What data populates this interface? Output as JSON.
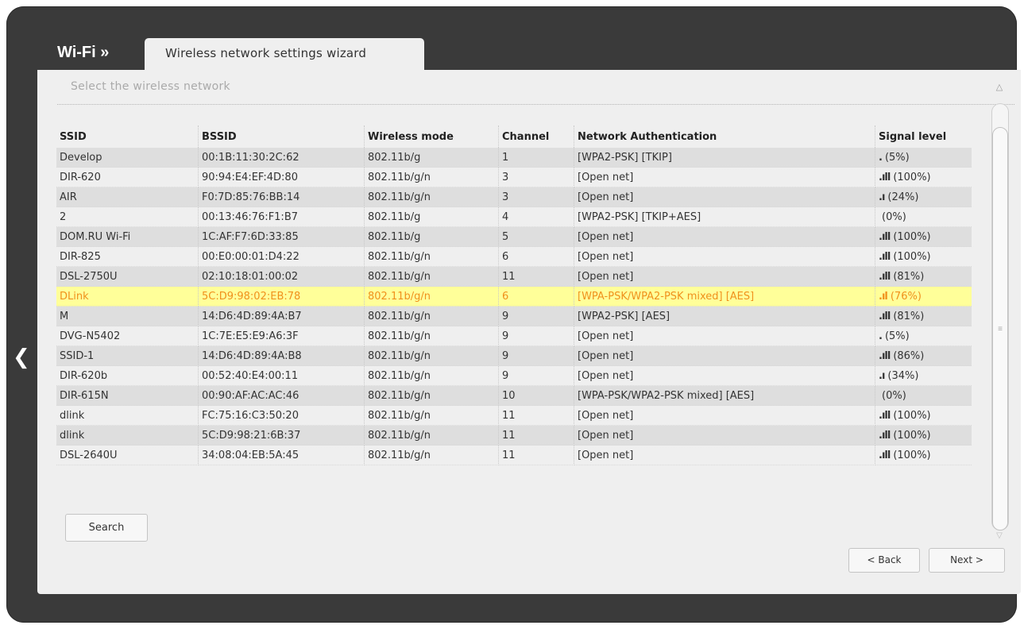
{
  "header": {
    "section": "Wi-Fi »",
    "tab_label": "Wireless network settings wizard"
  },
  "main": {
    "subtitle": "Select the wireless network",
    "columns": [
      "SSID",
      "BSSID",
      "Wireless mode",
      "Channel",
      "Network Authentication",
      "Signal level"
    ],
    "rows": [
      {
        "ssid": "Develop",
        "bssid": "00:1B:11:30:2C:62",
        "mode": "802.11b/g",
        "channel": "1",
        "auth": "[WPA2-PSK] [TKIP]",
        "signal": "(5%)",
        "signal_icon": ".",
        "selected": false
      },
      {
        "ssid": "DIR-620",
        "bssid": "90:94:E4:EF:4D:80",
        "mode": "802.11b/g/n",
        "channel": "3",
        "auth": "[Open net]",
        "signal": "(100%)",
        "signal_icon": ".ıll",
        "selected": false
      },
      {
        "ssid": "AIR",
        "bssid": "F0:7D:85:76:BB:14",
        "mode": "802.11b/g/n",
        "channel": "3",
        "auth": "[Open net]",
        "signal": "(24%)",
        "signal_icon": ".ı",
        "selected": false
      },
      {
        "ssid": "2",
        "bssid": "00:13:46:76:F1:B7",
        "mode": "802.11b/g",
        "channel": "4",
        "auth": "[WPA2-PSK] [TKIP+AES]",
        "signal": "(0%)",
        "signal_icon": "",
        "selected": false
      },
      {
        "ssid": "DOM.RU Wi-Fi",
        "bssid": "1C:AF:F7:6D:33:85",
        "mode": "802.11b/g",
        "channel": "5",
        "auth": "[Open net]",
        "signal": "(100%)",
        "signal_icon": ".ıll",
        "selected": false
      },
      {
        "ssid": "DIR-825",
        "bssid": "00:E0:00:01:D4:22",
        "mode": "802.11b/g/n",
        "channel": "6",
        "auth": "[Open net]",
        "signal": "(100%)",
        "signal_icon": ".ıll",
        "selected": false
      },
      {
        "ssid": "DSL-2750U",
        "bssid": "02:10:18:01:00:02",
        "mode": "802.11b/g/n",
        "channel": "11",
        "auth": "[Open net]",
        "signal": "(81%)",
        "signal_icon": ".ıll",
        "selected": false
      },
      {
        "ssid": "DLink",
        "bssid": "5C:D9:98:02:EB:78",
        "mode": "802.11b/g/n",
        "channel": "6",
        "auth": "[WPA-PSK/WPA2-PSK mixed] [AES]",
        "signal": "(76%)",
        "signal_icon": ".ıl",
        "selected": true
      },
      {
        "ssid": "M",
        "bssid": "14:D6:4D:89:4A:B7",
        "mode": "802.11b/g/n",
        "channel": "9",
        "auth": "[WPA2-PSK] [AES]",
        "signal": "(81%)",
        "signal_icon": ".ıll",
        "selected": false
      },
      {
        "ssid": "DVG-N5402",
        "bssid": "1C:7E:E5:E9:A6:3F",
        "mode": "802.11b/g/n",
        "channel": "9",
        "auth": "[Open net]",
        "signal": "(5%)",
        "signal_icon": ".",
        "selected": false
      },
      {
        "ssid": "SSID-1",
        "bssid": "14:D6:4D:89:4A:B8",
        "mode": "802.11b/g/n",
        "channel": "9",
        "auth": "[Open net]",
        "signal": "(86%)",
        "signal_icon": ".ıll",
        "selected": false
      },
      {
        "ssid": "DIR-620b",
        "bssid": "00:52:40:E4:00:11",
        "mode": "802.11b/g/n",
        "channel": "9",
        "auth": "[Open net]",
        "signal": "(34%)",
        "signal_icon": ".ı",
        "selected": false
      },
      {
        "ssid": "DIR-615N",
        "bssid": "00:90:AF:AC:AC:46",
        "mode": "802.11b/g/n",
        "channel": "10",
        "auth": "[WPA-PSK/WPA2-PSK mixed] [AES]",
        "signal": "(0%)",
        "signal_icon": "",
        "selected": false
      },
      {
        "ssid": "dlink",
        "bssid": "FC:75:16:C3:50:20",
        "mode": "802.11b/g/n",
        "channel": "11",
        "auth": "[Open net]",
        "signal": "(100%)",
        "signal_icon": ".ıll",
        "selected": false
      },
      {
        "ssid": "dlink",
        "bssid": "5C:D9:98:21:6B:37",
        "mode": "802.11b/g/n",
        "channel": "11",
        "auth": "[Open net]",
        "signal": "(100%)",
        "signal_icon": ".ıll",
        "selected": false
      },
      {
        "ssid": "DSL-2640U",
        "bssid": "34:08:04:EB:5A:45",
        "mode": "802.11b/g/n",
        "channel": "11",
        "auth": "[Open net]",
        "signal": "(100%)",
        "signal_icon": ".ıll",
        "selected": false
      }
    ],
    "search_label": "Search",
    "back_label": "< Back",
    "next_label": "Next >"
  },
  "colors": {
    "frame": "#3a3a3a",
    "panel": "#efefef",
    "selected_row_bg": "#ffff99",
    "selected_row_text": "#f0901c"
  },
  "icons": {
    "side_nav": "chevron-left-icon",
    "scroll_up": "scroll-up-icon",
    "scroll_down": "scroll-down-icon"
  }
}
